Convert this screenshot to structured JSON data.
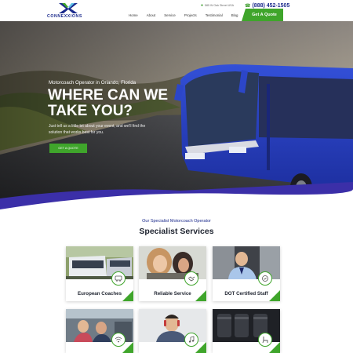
{
  "header": {
    "logo_text": "CONNEXXIONS",
    "address": "585 W Oak Street USA",
    "phone": "(888) 452-1505",
    "nav": [
      "Home",
      "About",
      "Service",
      "Projects",
      "Testimonial",
      "Blog"
    ],
    "cta_label": "Get A Quote"
  },
  "hero": {
    "subtitle": "Motorcoach Operator in Orlando, Florida",
    "title": "WHERE CAN WE TAKE YOU?",
    "text": "Just tell us a little bit about your event, and we'll find the solution that works best for you.",
    "button_label": "GET A QUOTE"
  },
  "services": {
    "kicker": "Our Specialist Motorcoach Operator",
    "title": "Specialist Services",
    "cards": [
      {
        "label": "European Coaches",
        "icon": "bus-icon"
      },
      {
        "label": "Reliable Service",
        "icon": "handshake-icon"
      },
      {
        "label": "DOT Certified Staff",
        "icon": "certified-icon"
      },
      {
        "label": "",
        "icon": "wifi-icon"
      },
      {
        "label": "",
        "icon": "music-icon"
      },
      {
        "label": "",
        "icon": "seat-icon"
      }
    ]
  },
  "colors": {
    "brand_blue": "#1b2a8c",
    "accent_green": "#3fa52b",
    "hero_purple": "#3b2fa8"
  }
}
